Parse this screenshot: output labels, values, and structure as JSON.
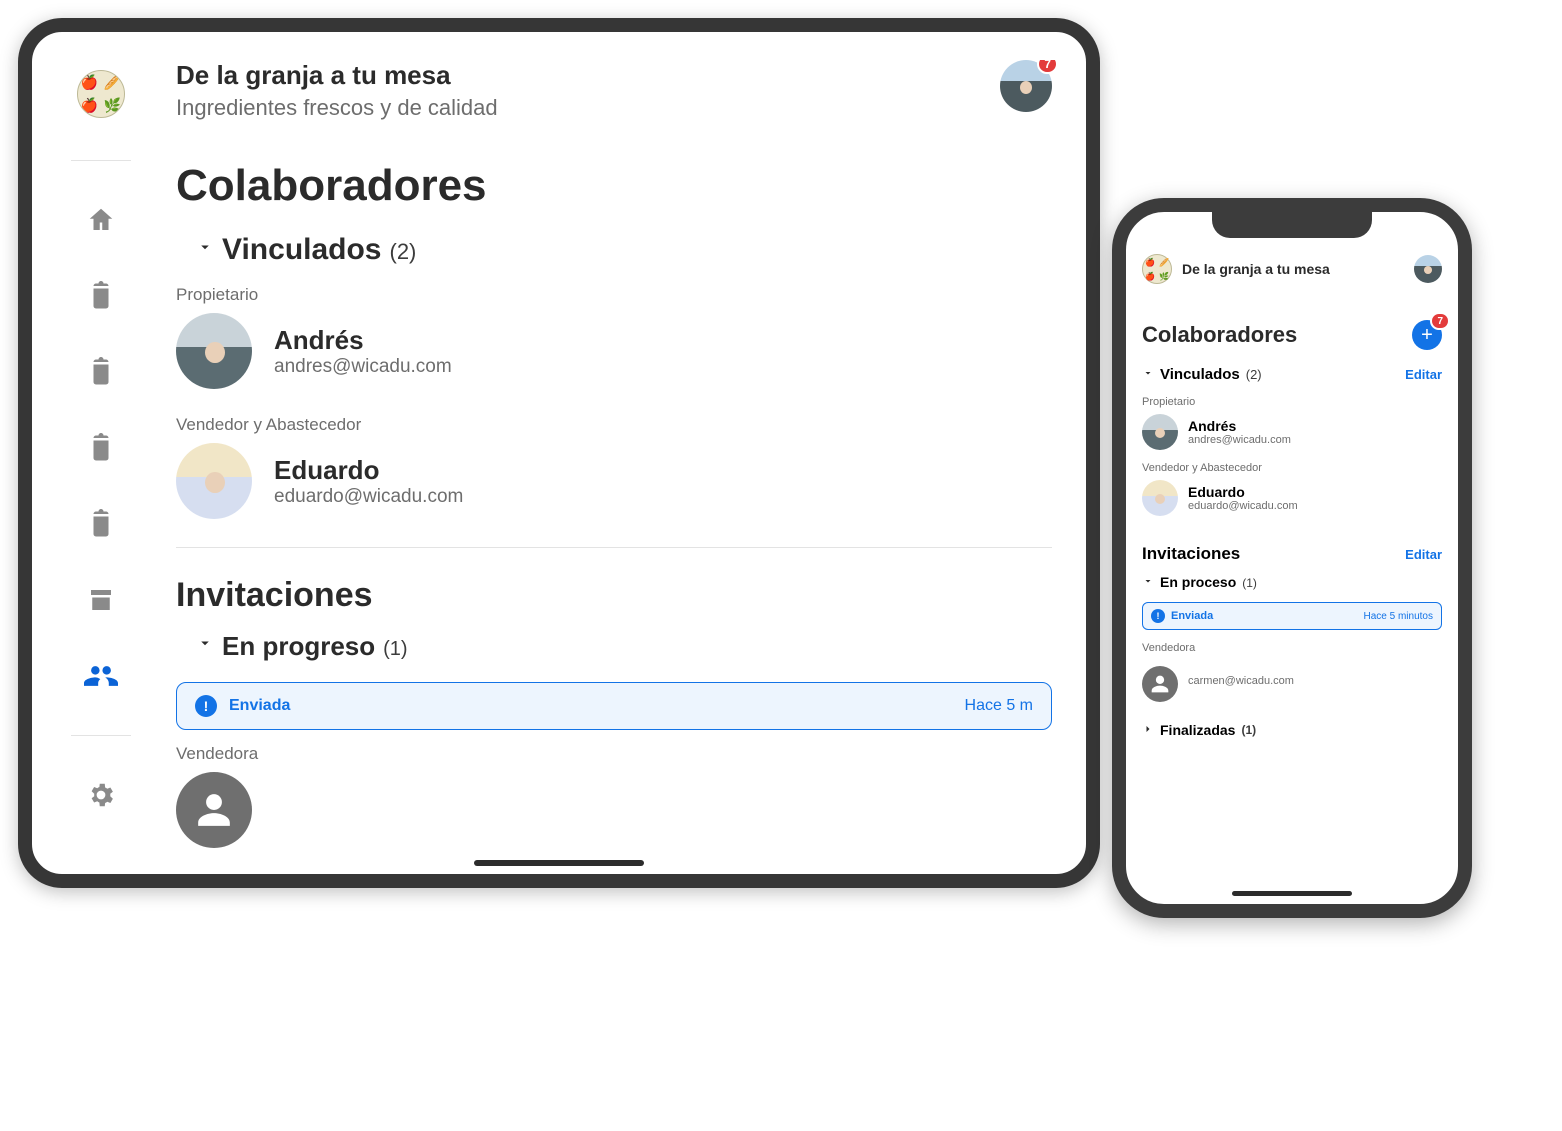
{
  "app": {
    "title": "De la granja a tu mesa",
    "subtitle": "Ingredientes frescos y de calidad"
  },
  "notification_count": "7",
  "collaborators": {
    "heading": "Colaboradores",
    "linked": {
      "label": "Vinculados",
      "count": "(2)",
      "edit": "Editar",
      "people": [
        {
          "role": "Propietario",
          "name": "Andrés",
          "email": "andres@wicadu.com"
        },
        {
          "role": "Vendedor y Abastecedor",
          "name": "Eduardo",
          "email": "eduardo@wicadu.com"
        }
      ]
    }
  },
  "invitations": {
    "heading_tablet": "Invitaciones",
    "heading_phone": "Invitaciones",
    "edit": "Editar",
    "in_progress": {
      "label_tablet": "En progreso",
      "label_phone": "En proceso",
      "count": "(1)",
      "status_label": "Enviada",
      "time_tablet": "Hace 5 m",
      "time_phone": "Hace 5 minutos",
      "pending": {
        "role": "Vendedora",
        "email": "carmen@wicadu.com"
      }
    },
    "finalized": {
      "label": "Finalizadas",
      "count": "(1)"
    }
  }
}
